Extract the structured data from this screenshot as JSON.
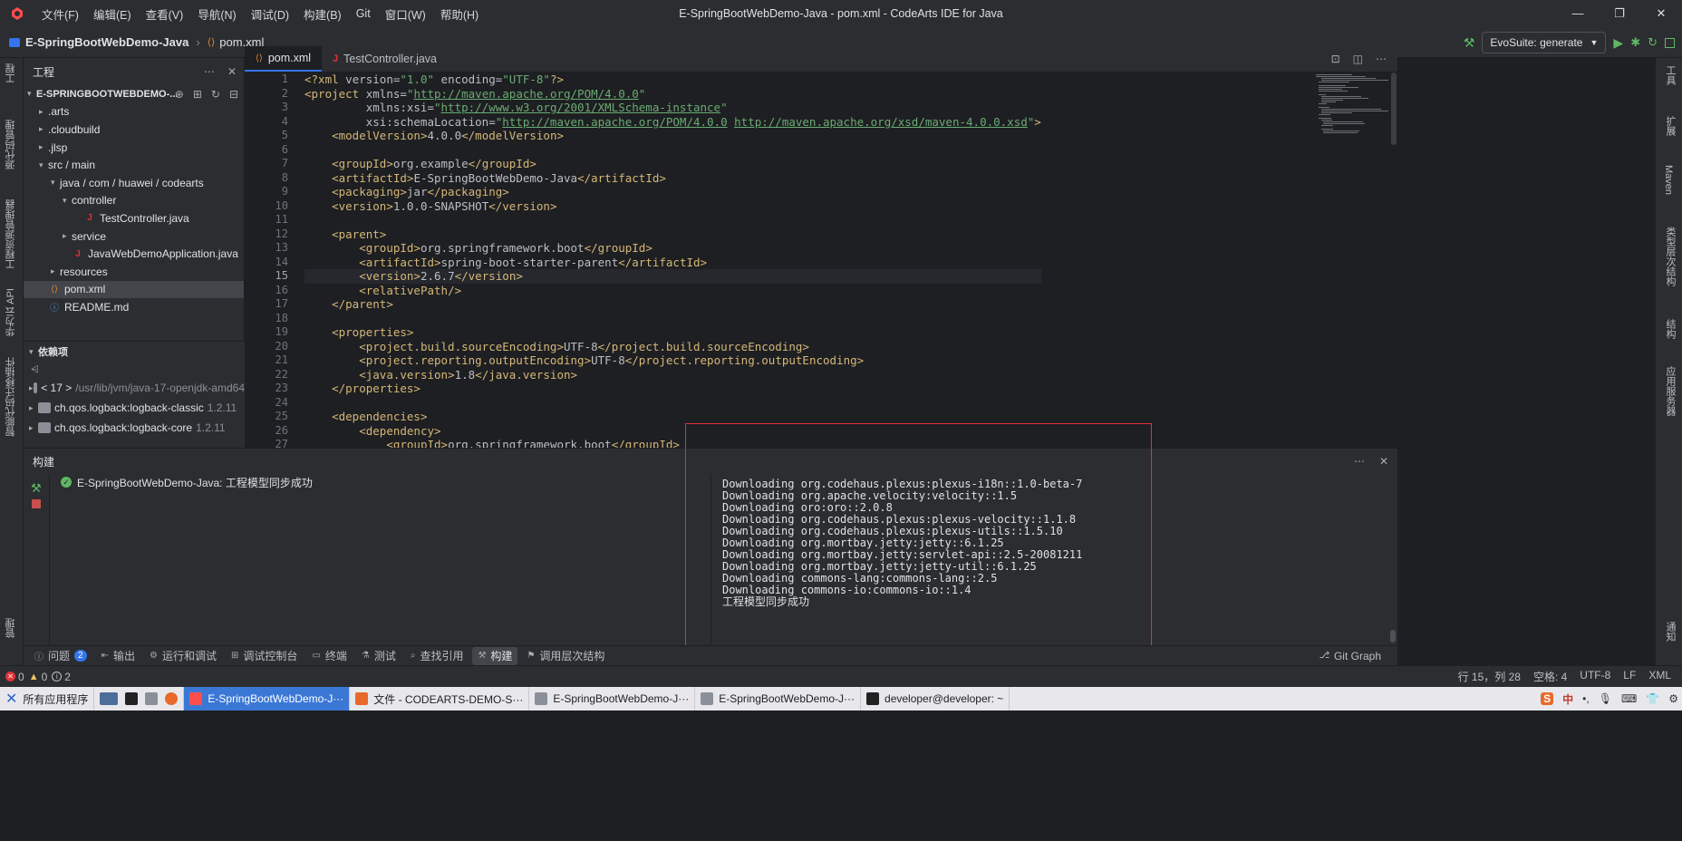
{
  "window": {
    "title": "E-SpringBootWebDemo-Java - pom.xml - CodeArts IDE for Java",
    "menu": [
      "文件(F)",
      "编辑(E)",
      "查看(V)",
      "导航(N)",
      "调试(D)",
      "构建(B)",
      "Git",
      "窗口(W)",
      "帮助(H)"
    ]
  },
  "navbar": {
    "project": "E-SpringBootWebDemo-Java",
    "file": "pom.xml",
    "evosuite_label": "EvoSuite: generate"
  },
  "left_strip": {
    "tabs": [
      "工程",
      "源代码管理",
      "工程资源管理器",
      "华为云 API",
      "智能代码迁移插件",
      "管理"
    ]
  },
  "right_strip": {
    "tabs": [
      "工具",
      "扩展",
      "Maven",
      "类型层次结构",
      "结构",
      "应用服务器",
      "通知"
    ]
  },
  "project_panel": {
    "title": "工程",
    "root": "E-SPRINGBOOTWEBDEMO-...",
    "items": [
      {
        "label": ".arts",
        "level": 1,
        "type": "folder",
        "arrow": "▸"
      },
      {
        "label": ".cloudbuild",
        "level": 1,
        "type": "folder",
        "arrow": "▸"
      },
      {
        "label": ".jlsp",
        "level": 1,
        "type": "folder",
        "arrow": "▸"
      },
      {
        "label": "src / main",
        "level": 1,
        "type": "folder",
        "arrow": "▾"
      },
      {
        "label": "java / com / huawei / codearts",
        "level": 2,
        "type": "folder",
        "arrow": "▾"
      },
      {
        "label": "controller",
        "level": 3,
        "type": "folder",
        "arrow": "▾"
      },
      {
        "label": "TestController.java",
        "level": 4,
        "type": "java",
        "arrow": ""
      },
      {
        "label": "service",
        "level": 3,
        "type": "folder",
        "arrow": "▸"
      },
      {
        "label": "JavaWebDemoApplication.java",
        "level": 3,
        "type": "java",
        "arrow": ""
      },
      {
        "label": "resources",
        "level": 2,
        "type": "folder",
        "arrow": "▸"
      },
      {
        "label": "pom.xml",
        "level": 1,
        "type": "xml",
        "arrow": "",
        "selected": true
      },
      {
        "label": "README.md",
        "level": 1,
        "type": "info",
        "arrow": ""
      }
    ]
  },
  "deps_panel": {
    "title": "依赖项",
    "items": [
      {
        "name": "< 17 >",
        "detail": "/usr/lib/jvm/java-17-openjdk-amd64"
      },
      {
        "name": "ch.qos.logback:logback-classic",
        "detail": "1.2.11"
      },
      {
        "name": "ch.qos.logback:logback-core",
        "detail": "1.2.11"
      }
    ]
  },
  "editor_tabs": [
    {
      "label": "pom.xml",
      "active": true
    },
    {
      "label": "TestController.java",
      "active": false
    }
  ],
  "editor": {
    "current_line": 15,
    "lines": [
      "<?xml version=\"1.0\" encoding=\"UTF-8\"?>",
      "<project xmlns=\"http://maven.apache.org/POM/4.0.0\"",
      "         xmlns:xsi=\"http://www.w3.org/2001/XMLSchema-instance\"",
      "         xsi:schemaLocation=\"http://maven.apache.org/POM/4.0.0 http://maven.apache.org/xsd/maven-4.0.0.xsd\">",
      "    <modelVersion>4.0.0</modelVersion>",
      "",
      "    <groupId>org.example</groupId>",
      "    <artifactId>E-SpringBootWebDemo-Java</artifactId>",
      "    <packaging>jar</packaging>",
      "    <version>1.0.0-SNAPSHOT</version>",
      "",
      "    <parent>",
      "        <groupId>org.springframework.boot</groupId>",
      "        <artifactId>spring-boot-starter-parent</artifactId>",
      "        <version>2.6.7</version>",
      "        <relativePath/>",
      "    </parent>",
      "",
      "    <properties>",
      "        <project.build.sourceEncoding>UTF-8</project.build.sourceEncoding>",
      "        <project.reporting.outputEncoding>UTF-8</project.reporting.outputEncoding>",
      "        <java.version>1.8</java.version>",
      "    </properties>",
      "",
      "    <dependencies>",
      "        <dependency>",
      "            <groupId>org.springframework.boot</groupId>"
    ]
  },
  "build_panel": {
    "title": "构建",
    "tree_item": "E-SpringBootWebDemo-Java: 工程模型同步成功",
    "log": [
      "Downloading org.codehaus.plexus:plexus-i18n::1.0-beta-7",
      "Downloading org.apache.velocity:velocity::1.5",
      "Downloading oro:oro::2.0.8",
      "Downloading org.codehaus.plexus:plexus-velocity::1.1.8",
      "Downloading org.codehaus.plexus:plexus-utils::1.5.10",
      "Downloading org.mortbay.jetty:jetty::6.1.25",
      "Downloading org.mortbay.jetty:servlet-api::2.5-20081211",
      "Downloading org.mortbay.jetty:jetty-util::6.1.25",
      "Downloading commons-lang:commons-lang::2.5",
      "Downloading commons-io:commons-io::1.4",
      "工程模型同步成功"
    ]
  },
  "bottom_tabs": [
    {
      "label": "问题",
      "badge": "2"
    },
    {
      "label": "输出"
    },
    {
      "label": "运行和调试"
    },
    {
      "label": "调试控制台"
    },
    {
      "label": "终端"
    },
    {
      "label": "测试"
    },
    {
      "label": "查找引用"
    },
    {
      "label": "构建",
      "active": true
    },
    {
      "label": "调用层次结构"
    }
  ],
  "git_graph_label": "Git Graph",
  "statusbar": {
    "errors": "0",
    "warnings": "0",
    "infos": "2",
    "position": "行 15，列 28",
    "indent": "空格: 4",
    "encoding": "UTF-8",
    "eol": "LF",
    "language": "XML"
  },
  "taskbar": {
    "start": "所有应用程序",
    "items": [
      {
        "label": "E-SpringBootWebDemo-J···",
        "active": true
      },
      {
        "label": "文件 - CODEARTS-DEMO-S···"
      },
      {
        "label": "E-SpringBootWebDemo-J···"
      },
      {
        "label": "E-SpringBootWebDemo-J···"
      },
      {
        "label": "developer@developer: ~"
      }
    ]
  },
  "colors": {
    "accent": "#3574f0",
    "success": "#5fb865",
    "highlight_box": "#e0323a"
  }
}
